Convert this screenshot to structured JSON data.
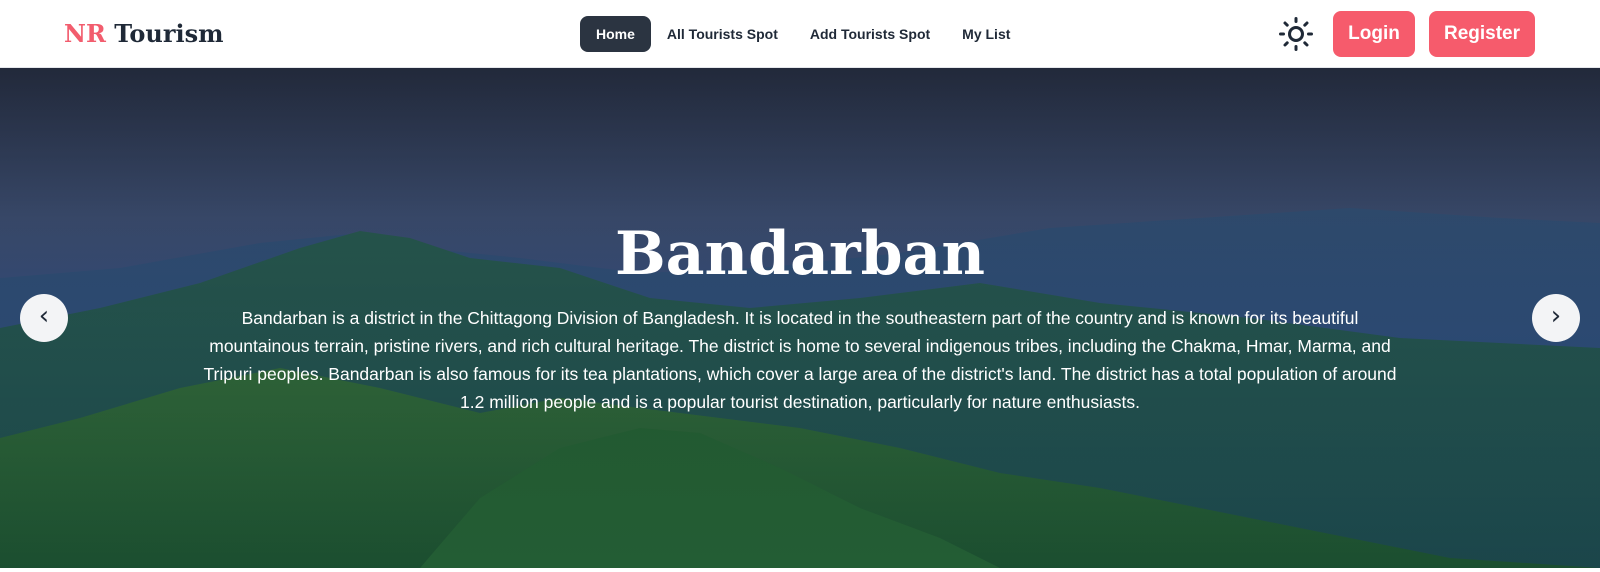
{
  "brand": {
    "accent": "NR",
    "name": "Tourism"
  },
  "nav": {
    "items": [
      {
        "label": "Home",
        "active": true
      },
      {
        "label": "All Tourists Spot",
        "active": false
      },
      {
        "label": "Add Tourists Spot",
        "active": false
      },
      {
        "label": "My List",
        "active": false
      }
    ]
  },
  "theme_toggle": {
    "icon": "sun-icon"
  },
  "auth": {
    "login_label": "Login",
    "register_label": "Register"
  },
  "hero": {
    "title": "Bandarban",
    "description": "Bandarban is a district in the Chittagong Division of Bangladesh. It is located in the southeastern part of the country and is known for its beautiful mountainous terrain, pristine rivers, and rich cultural heritage. The district is home to several indigenous tribes, including the Chakma, Hmar, Marma, and Tripuri peoples. Bandarban is also famous for its tea plantations, which cover a large area of the district's land. The district has a total population of around 1.2 million people and is a popular tourist destination, particularly for nature enthusiasts.",
    "prev_symbol": "‹",
    "next_symbol": "›"
  },
  "colors": {
    "brand_accent": "#f25d6e",
    "button": "#f65b6c",
    "active_nav": "#2b3441",
    "text_dark": "#1f2937"
  }
}
